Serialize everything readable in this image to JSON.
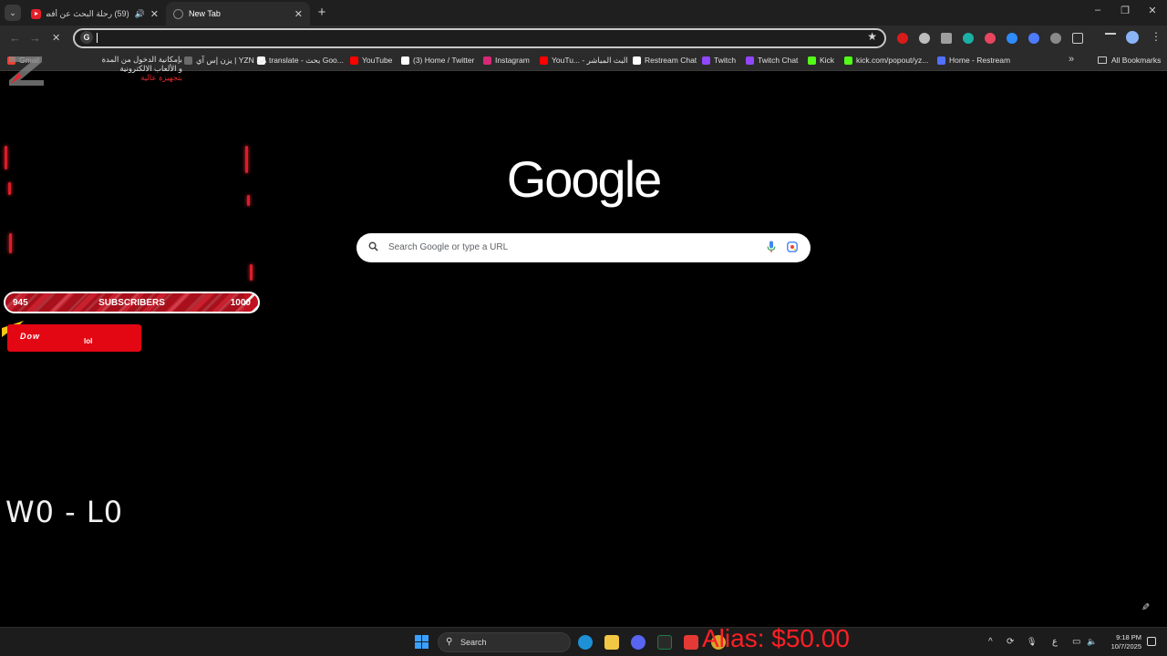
{
  "browser": {
    "tabs": [
      {
        "title": "(59) رحلة البحث عن أفضل س...",
        "favicon": "youtube-icon",
        "audio": "speaker-icon"
      },
      {
        "title": "New Tab",
        "favicon": "new-tab-icon"
      }
    ],
    "tab_search_glyph": "⌄",
    "close_glyph": "✕",
    "new_tab_glyph": "+",
    "window_controls": {
      "minimize": "–",
      "restore": "❐",
      "close": "✕"
    },
    "address_bar": {
      "value": "",
      "site_icon": "G",
      "bookmark_star": "★"
    },
    "nav": {
      "back": "←",
      "forward": "→",
      "reload": "✕"
    },
    "menu_glyph": "⋮"
  },
  "bookmarks": {
    "items": [
      {
        "label": "Gmail",
        "icon": "gmail-icon",
        "color": "#ea4335"
      },
      {
        "label": "يزن إس آي | YZN SA",
        "icon": "yzn-icon",
        "color": "#6b6b6b"
      },
      {
        "label": "translate - بحث Goo...",
        "icon": "google-icon",
        "color": "#ffffff"
      },
      {
        "label": "YouTube",
        "icon": "youtube-icon",
        "color": "#ff0000"
      },
      {
        "label": "(3) Home / Twitter",
        "icon": "x-icon",
        "color": "#ffffff"
      },
      {
        "label": "Instagram",
        "icon": "instagram-icon",
        "color": "#d62976"
      },
      {
        "label": "YouTu... - البث المباشر",
        "icon": "youtube-icon",
        "color": "#ff0000"
      },
      {
        "label": "Restream Chat",
        "icon": "restream-icon",
        "color": "#ffffff"
      },
      {
        "label": "Twitch",
        "icon": "twitch-icon",
        "color": "#9146ff"
      },
      {
        "label": "Twitch Chat",
        "icon": "twitch-icon",
        "color": "#9146ff"
      },
      {
        "label": "Kick",
        "icon": "kick-icon",
        "color": "#53fc18"
      },
      {
        "label": "kick.com/popout/yz...",
        "icon": "kick-icon",
        "color": "#53fc18"
      },
      {
        "label": "Home - Restream",
        "icon": "restream-icon",
        "color": "#5271ff"
      }
    ],
    "more": "»",
    "all_bookmarks": "All Bookmarks"
  },
  "ntp": {
    "logo": "Google",
    "search_placeholder": "Search Google or type a URL",
    "edit_glyph": "✎"
  },
  "overlay": {
    "logo_text": "Z",
    "header_lines": [
      "بإمكانية الدخول من المدة",
      "و الألعاب الالكترونية",
      "بتجهيزة عالية"
    ],
    "subscribers": {
      "label": "SUBSCRIBERS",
      "current": "945",
      "goal": "1000",
      "progress": 0.945
    },
    "alert_text": "Dow",
    "alert_text2": "lol",
    "record": "W0 - L0",
    "donation": "Alias: $50.00"
  },
  "taskbar": {
    "search_label": "Search",
    "search_glyph": "⚲",
    "clock_time": "9:18 PM",
    "clock_date": "10/7/2025",
    "tray_icons": {
      "chevron": "^",
      "sync": "⟳",
      "mic": "🎙",
      "lang": "ع",
      "display": "▭",
      "volume": "🔈"
    }
  },
  "colors": {
    "accent_red": "#e30613",
    "ntp_bg": "#000000",
    "chrome_dark": "#2b2b2b"
  }
}
